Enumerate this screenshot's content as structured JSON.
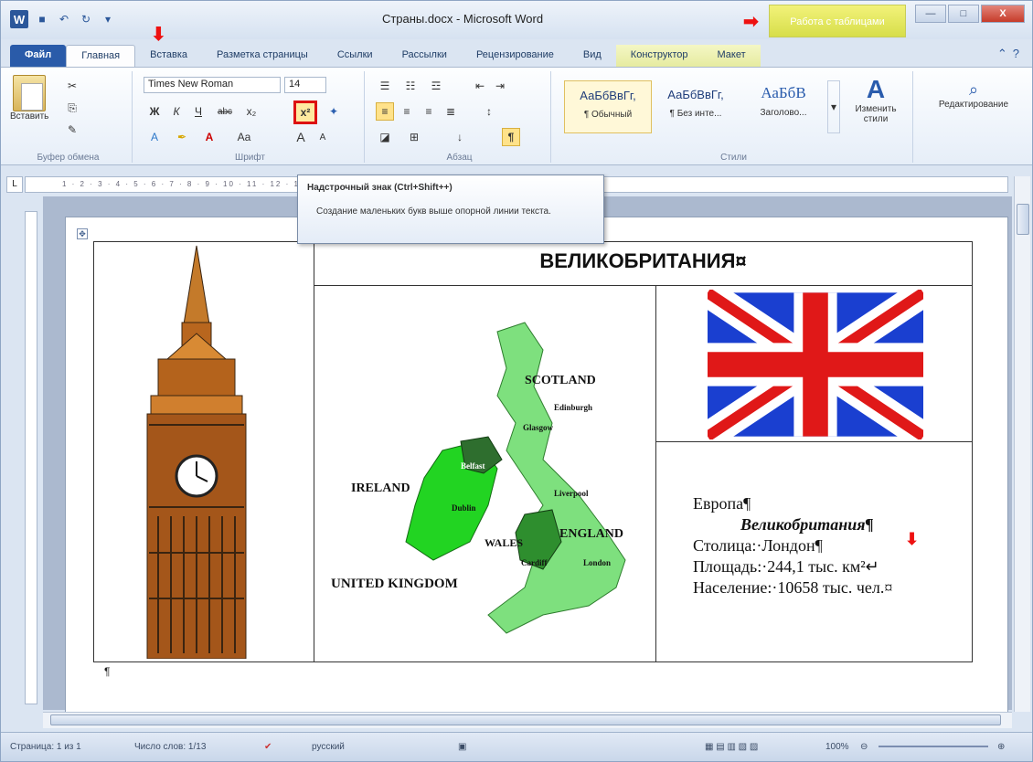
{
  "window": {
    "title": "Страны.docx - Microsoft Word",
    "context_tab": "Работа с таблицами"
  },
  "tabs": [
    "Файл",
    "Главная",
    "Вставка",
    "Разметка страницы",
    "Ссылки",
    "Рассылки",
    "Рецензирование",
    "Вид",
    "Конструктор",
    "Макет"
  ],
  "clipboard": {
    "paste": "Вставить",
    "label": "Буфер обмена"
  },
  "font": {
    "name": "Times New Roman",
    "size": "14",
    "label": "Шрифт",
    "bold": "Ж",
    "italic": "К",
    "underline": "Ч",
    "strike": "abc",
    "subscript": "x₂",
    "superscript": "x²",
    "aa": "Aa",
    "grow": "A",
    "shrink": "A"
  },
  "paragraph": {
    "label": "Абзац",
    "pilcrow": "¶"
  },
  "styles": {
    "label": "Стили",
    "items": [
      {
        "sample": "АаБбВвГг,",
        "name": "¶ Обычный"
      },
      {
        "sample": "АаБбВвГг,",
        "name": "¶ Без инте..."
      },
      {
        "sample": "АаБбВ",
        "name": "Заголово..."
      }
    ],
    "change": "Изменить стили"
  },
  "editing": {
    "label": "Редактирование"
  },
  "tooltip": {
    "title": "Надстрочный знак (Ctrl+Shift++)",
    "body": "Создание маленьких букв выше опорной линии текста."
  },
  "document": {
    "country_title": "ВЕЛИКОБРИТАНИЯ¤",
    "info": {
      "line1": "Европа¶",
      "line2": "Великобритания¶",
      "line3": "Столица:·Лондон¶",
      "line4": "Площадь:·244,1 тыс. км²↵",
      "line5": "Население:·10658 тыс. чел.¤"
    },
    "map_labels": {
      "scotland": "SCOTLAND",
      "edinburgh": "Edinburgh",
      "glasgow": "Glasgow",
      "ireland": "IRELAND",
      "belfast": "Belfast",
      "dublin": "Dublin",
      "liverpool": "Liverpool",
      "wales": "WALES",
      "england": "ENGLAND",
      "cardiff": "Cardiff",
      "london": "London",
      "uk": "UNITED KINGDOM"
    },
    "para_mark": "¶"
  },
  "status": {
    "page": "Страница: 1 из 1",
    "words": "Число слов: 1/13",
    "lang": "русский",
    "zoom": "100%"
  }
}
